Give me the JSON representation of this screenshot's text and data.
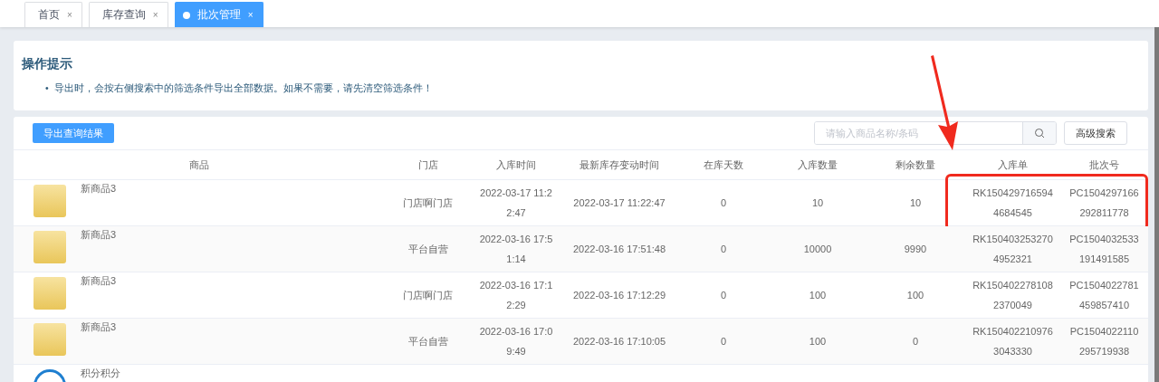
{
  "tabs": [
    {
      "label": "首页",
      "close": "×",
      "selected": false
    },
    {
      "label": "库存查询",
      "close": "×",
      "selected": false
    },
    {
      "label": "批次管理",
      "close": "×",
      "selected": true
    }
  ],
  "tip": {
    "title": "操作提示",
    "items": [
      {
        "bullet": "•",
        "text": "导出时，会按右侧搜索中的筛选条件导出全部数据。如果不需要，请先清空筛选条件！"
      }
    ]
  },
  "toolbar": {
    "export_button": "导出查询结果",
    "search": {
      "placeholder": "请输入商品名称/条码"
    },
    "advanced_button": "高级搜索"
  },
  "table": {
    "columns": [
      "商品",
      "门店",
      "入库时间",
      "最新库存变动时间",
      "在库天数",
      "入库数量",
      "剩余数量",
      "入库单",
      "批次号"
    ],
    "rows": [
      {
        "product": {
          "name": "新商品3",
          "kind": "tub"
        },
        "store": "门店啊门店",
        "in_time": "2022-03-17 11:22:47",
        "last_change_time": "2022-03-17 11:22:47",
        "days": "0",
        "in_qty": "10",
        "remaining_qty": "10",
        "receipt_no": "RK1504297165944684545",
        "batch_no": "PC1504297166292811778",
        "highlighted": true
      },
      {
        "product": {
          "name": "新商品3",
          "kind": "tub"
        },
        "store": "平台自营",
        "in_time": "2022-03-16 17:51:14",
        "last_change_time": "2022-03-16 17:51:48",
        "days": "0",
        "in_qty": "10000",
        "remaining_qty": "9990",
        "receipt_no": "RK1504032532704952321",
        "batch_no": "PC1504032533191491585",
        "highlighted": false
      },
      {
        "product": {
          "name": "新商品3",
          "kind": "tub"
        },
        "store": "门店啊门店",
        "in_time": "2022-03-16 17:12:29",
        "last_change_time": "2022-03-16 17:12:29",
        "days": "0",
        "in_qty": "100",
        "remaining_qty": "100",
        "receipt_no": "RK1504022781082370049",
        "batch_no": "PC1504022781459857410",
        "highlighted": false
      },
      {
        "product": {
          "name": "新商品3",
          "kind": "tub"
        },
        "store": "平台自营",
        "in_time": "2022-03-16 17:09:49",
        "last_change_time": "2022-03-16 17:10:05",
        "days": "0",
        "in_qty": "100",
        "remaining_qty": "0",
        "receipt_no": "RK1504022109763043330",
        "batch_no": "PC1504022110295719938",
        "highlighted": false
      },
      {
        "product": {
          "name": "积分积分",
          "kind": "ring"
        },
        "highlighted": false
      }
    ]
  }
}
